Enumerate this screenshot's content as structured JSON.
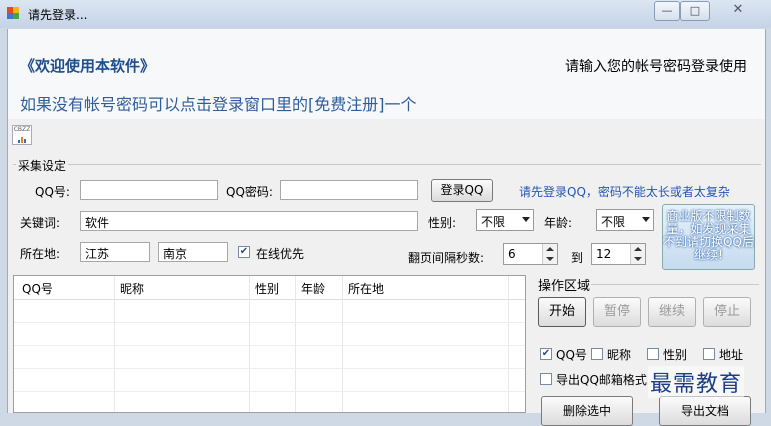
{
  "window": {
    "title": "请先登录...",
    "minimize": "—",
    "maximize": "□",
    "close": "✕"
  },
  "banner": {
    "welcome": "《欢迎使用本软件》",
    "prompt": "请输入您的帐号密码登录使用",
    "hint": "如果没有帐号密码可以点击登录窗口里的[免费注册]一个",
    "cbzz": "CBZZ"
  },
  "collect": {
    "legend": "采集设定",
    "qq_label": "QQ号:",
    "qq_value": "",
    "password_label": "QQ密码:",
    "password_value": "",
    "login_button": "登录QQ",
    "login_tip": "请先登录QQ，密码不能太长或者太复杂",
    "keyword_label": "关键词:",
    "keyword_value": "软件",
    "gender_label": "性别:",
    "gender_value": "不限",
    "age_label": "年龄:",
    "age_value": "不限",
    "location_label": "所在地:",
    "province_value": "江苏",
    "city_value": "南京",
    "online_first_label": "在线优先",
    "online_first_checked": true,
    "page_interval_label": "翻页间隔秒数:",
    "interval_from": "6",
    "to_label": "到",
    "interval_to": "12",
    "notice": "商业版不限制数量，如发现采集不到请切换QQ后继续!"
  },
  "table": {
    "columns": [
      "QQ号",
      "昵称",
      "性别",
      "年龄",
      "所在地"
    ]
  },
  "ops": {
    "legend": "操作区域",
    "start": "开始",
    "pause": "暂停",
    "resume": "继续",
    "stop": "停止",
    "opt_qq": "QQ号",
    "opt_nick": "昵称",
    "opt_gender": "性别",
    "opt_address": "地址",
    "export_mail": "导出QQ邮箱格式",
    "delete_selected": "删除选中",
    "export_doc": "导出文档"
  },
  "watermark": "最需教育"
}
